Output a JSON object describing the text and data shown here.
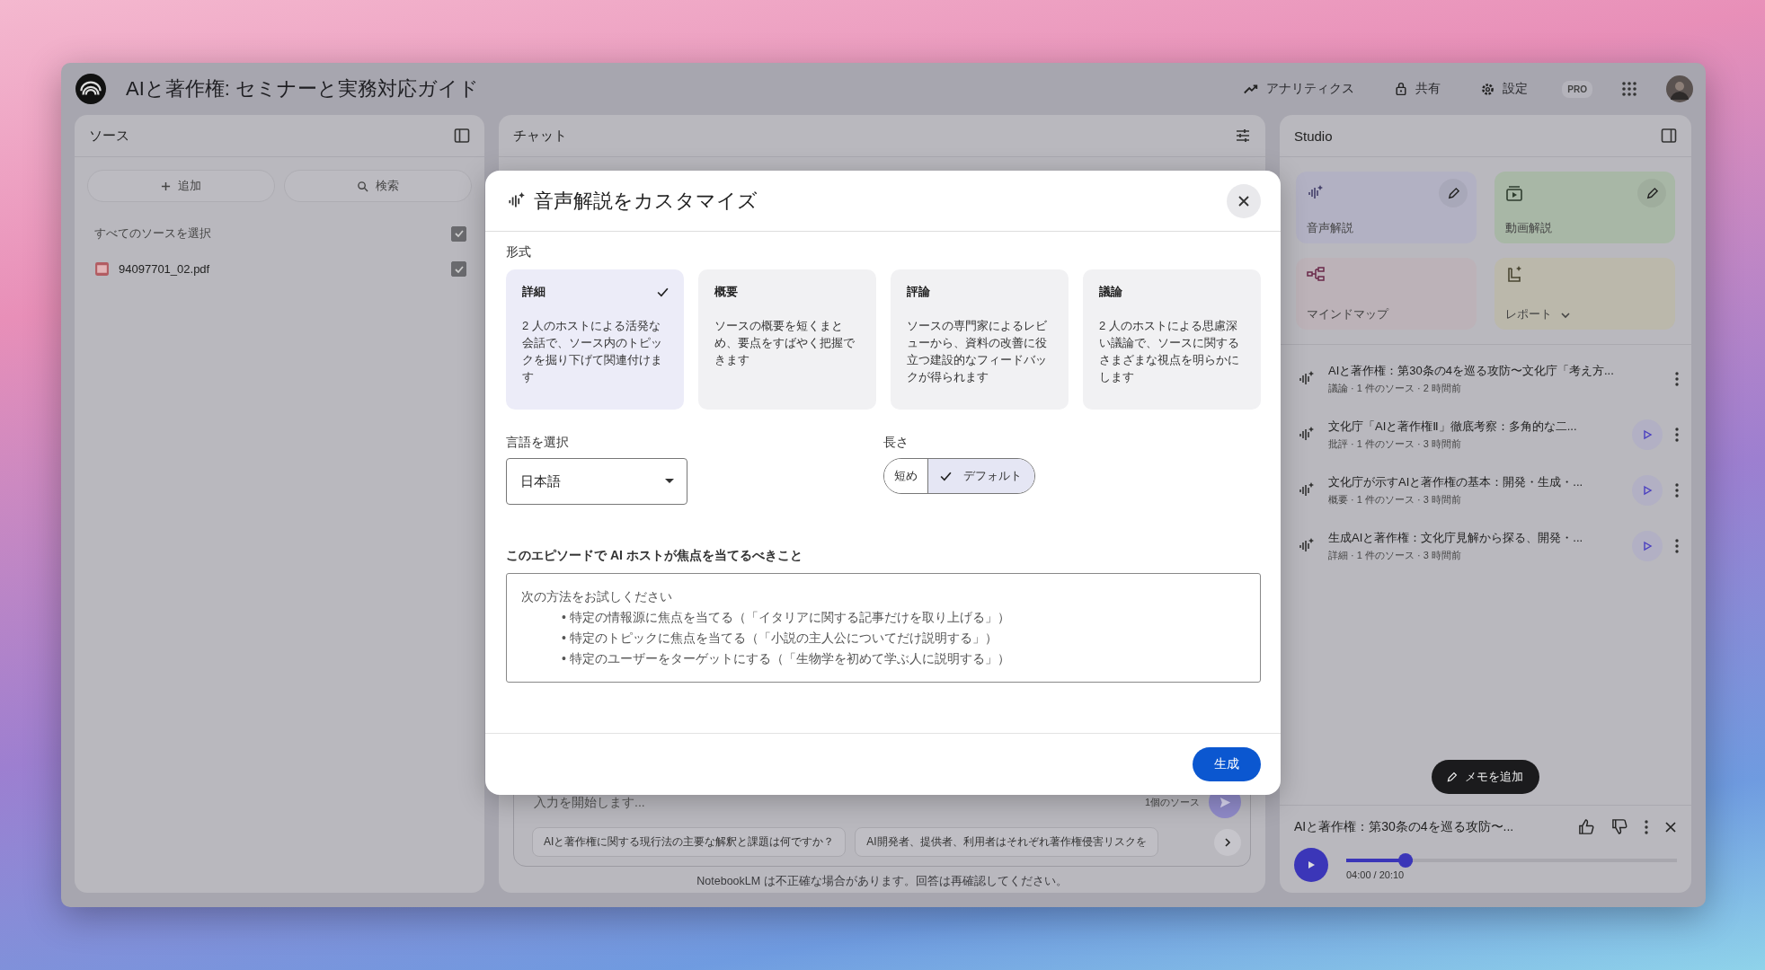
{
  "header": {
    "title": "AIと著作権: セミナーと実務対応ガイド",
    "actions": [
      {
        "kind": "analytics",
        "label": "アナリティクス"
      },
      {
        "kind": "share",
        "label": "共有"
      },
      {
        "kind": "settings",
        "label": "設定"
      }
    ],
    "badge": "PRO"
  },
  "sources": {
    "title": "ソース",
    "buttons": [
      {
        "kind": "add",
        "label": "追加"
      },
      {
        "kind": "search",
        "label": "検索"
      }
    ],
    "select_all": {
      "label": "すべてのソースを選択",
      "checked": true
    },
    "items": [
      {
        "name": "94097701_02.pdf",
        "checked": true
      }
    ]
  },
  "chat": {
    "title": "チャット",
    "placeholder": "入力を開始します...",
    "source_count": "1個のソース",
    "suggestions": [
      "AIと著作権に関する現行法の主要な解釈と課題は何ですか？",
      "AI開発者、提供者、利用者はそれぞれ著作権侵害リスクを"
    ],
    "footer": "NotebookLM は不正確な場合があります。回答は再確認してください。"
  },
  "studio": {
    "title": "Studio",
    "tiles": [
      {
        "kind": "audio",
        "label": "音声解説",
        "editable": true,
        "dropdown": false,
        "color": "#b2b1c3"
      },
      {
        "kind": "video",
        "label": "動画解説",
        "editable": true,
        "dropdown": false,
        "color": "#a8b7a6"
      },
      {
        "kind": "mindmap",
        "label": "マインドマップ",
        "editable": false,
        "dropdown": false,
        "color": "#bcb2b8"
      },
      {
        "kind": "report",
        "label": "レポート",
        "editable": false,
        "dropdown": true,
        "color": "#bbb8ab"
      }
    ],
    "items": [
      {
        "title": "AIと著作権：第30条の4を巡る攻防〜文化庁「考え方...",
        "meta": "議論 · 1 件のソース · 2 時間前",
        "playable": false
      },
      {
        "title": "文化庁「AIと著作権Ⅱ」徹底考察：多角的な二...",
        "meta": "批評 · 1 件のソース · 3 時間前",
        "playable": true
      },
      {
        "title": "文化庁が示すAIと著作権の基本：開発・生成・...",
        "meta": "概要 · 1 件のソース · 3 時間前",
        "playable": true
      },
      {
        "title": "生成AIと著作権：文化庁見解から探る、開発・...",
        "meta": "詳細 · 1 件のソース · 3 時間前",
        "playable": true
      }
    ],
    "add_note": "メモを追加",
    "player": {
      "title": "AIと著作権：第30条の4を巡る攻防〜...",
      "time": "04:00 / 20:10",
      "level": 0.2
    }
  },
  "dialog": {
    "title": "音声解説をカスタマイズ",
    "format_label": "形式",
    "formats": [
      {
        "name": "詳細",
        "description": "2 人のホストによる活発な会話で、ソース内のトピックを掘り下げて関連付けます",
        "selected": true
      },
      {
        "name": "概要",
        "description": "ソースの概要を短くまとめ、要点をすばやく把握できます",
        "selected": false
      },
      {
        "name": "評論",
        "description": "ソースの専門家によるレビューから、資料の改善に役立つ建設的なフィードバックが得られます",
        "selected": false
      },
      {
        "name": "議論",
        "description": "2 人のホストによる思慮深い議論で、ソースに関するさまざまな視点を明らかにします",
        "selected": false
      }
    ],
    "language_label": "言語を選択",
    "language": "日本語",
    "length_label": "長さ",
    "lengths": [
      {
        "label": "短め",
        "selected": false
      },
      {
        "label": "デフォルト",
        "selected": true
      }
    ],
    "focus_label": "このエピソードで AI ホストが焦点を当てるべきこと",
    "focus_hint": "次の方法をお試しください",
    "focus_examples": [
      "• 特定の情報源に焦点を当てる（「イタリアに関する記事だけを取り上げる」）",
      "• 特定のトピックに焦点を当てる（「小説の主人公についてだけ説明する」）",
      "• 特定のユーザーをターゲットにする（「生物学を初めて学ぶ人に説明する」）"
    ],
    "generate": "生成"
  }
}
